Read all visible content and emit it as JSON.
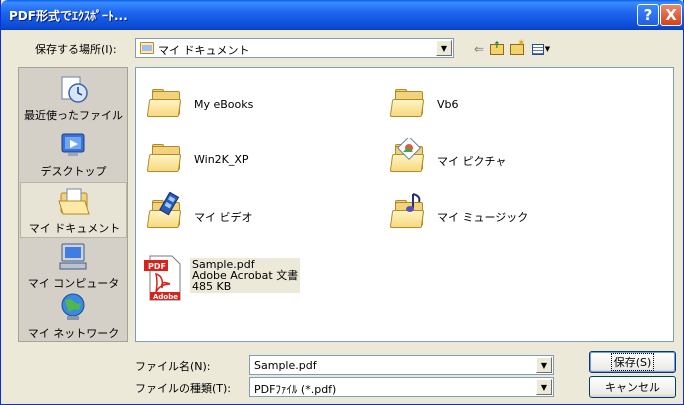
{
  "window": {
    "title": "PDF形式でｴｸｽﾎﾟｰﾄ...",
    "help_button": "?",
    "close_button": "X"
  },
  "save_in": {
    "label": "保存する場所(I):",
    "label_underline": "I",
    "value": "マイ ドキュメント"
  },
  "places": [
    {
      "label": "最近使ったファイル",
      "icon": "recent-documents-icon",
      "selected": false
    },
    {
      "label": "デスクトップ",
      "icon": "desktop-icon",
      "selected": false
    },
    {
      "label": "マイ ドキュメント",
      "icon": "my-documents-icon",
      "selected": true
    },
    {
      "label": "マイ コンピュータ",
      "icon": "my-computer-icon",
      "selected": false
    },
    {
      "label": "マイ ネットワーク",
      "icon": "my-network-icon",
      "selected": false
    }
  ],
  "files": [
    {
      "name": "My eBooks",
      "icon": "folder-icon"
    },
    {
      "name": "Vb6",
      "icon": "folder-icon"
    },
    {
      "name": "Win2K_XP",
      "icon": "folder-icon"
    },
    {
      "name": "マイ ピクチャ",
      "icon": "my-pictures-folder-icon"
    },
    {
      "name": "マイ ビデオ",
      "icon": "my-videos-folder-icon"
    },
    {
      "name": "マイ ミュージック",
      "icon": "my-music-folder-icon"
    }
  ],
  "selected_file": {
    "name": "Sample.pdf",
    "type": "Adobe Acrobat 文書",
    "size": "485 KB",
    "icon": "pdf-file-icon"
  },
  "filename": {
    "label": "ファイル名(N):",
    "value": "Sample.pdf"
  },
  "filetype": {
    "label": "ファイルの種類(T):",
    "value": "PDFﾌｧｲﾙ (*.pdf)"
  },
  "buttons": {
    "save": "保存(S)",
    "cancel": "キャンセル"
  },
  "colors": {
    "titlebar": "#0A4CD6",
    "face": "#ECE9D8",
    "folder": "#F2D27D"
  }
}
